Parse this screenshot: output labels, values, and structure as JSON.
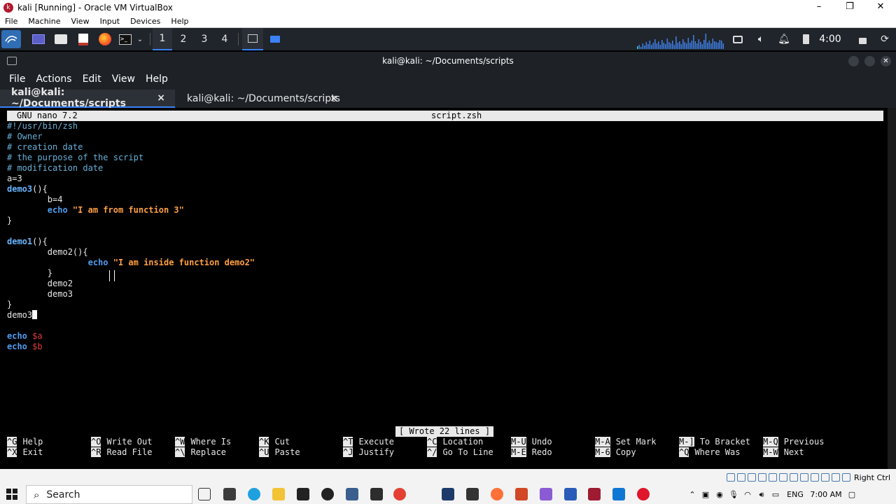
{
  "host_window": {
    "title": "kali [Running] - Oracle VM VirtualBox",
    "menu": [
      "File",
      "Machine",
      "View",
      "Input",
      "Devices",
      "Help"
    ]
  },
  "kali_panel": {
    "workspaces": [
      "1",
      "2",
      "3",
      "4"
    ],
    "active_workspace": "1",
    "clock": "4:00"
  },
  "terminal": {
    "title": "kali@kali: ~/Documents/scripts",
    "menu": [
      "File",
      "Actions",
      "Edit",
      "View",
      "Help"
    ],
    "tabs": [
      {
        "label": "kali@kali: ~/Documents/scripts",
        "close": "×"
      },
      {
        "label": "kali@kali: ~/Documents/scripts",
        "close": "×"
      }
    ]
  },
  "nano": {
    "version": "GNU nano 7.2",
    "filename": "script.zsh",
    "status_message": "[ Wrote 22 lines ]",
    "lines": {
      "l1": "#!/usr/bin/zsh",
      "l2": "# Owner",
      "l3": "# creation date",
      "l4": "# the purpose of the script",
      "l5": "# modification date",
      "l6": "a=3",
      "l7_fn": "demo3",
      "l7_rest": "(){",
      "l8": "        b=4",
      "l9_indent": "        ",
      "l9_kw": "echo",
      "l9_str": " \"I am from function 3\"",
      "l10": "}",
      "l12_fn": "demo1",
      "l12_rest": "(){",
      "l13": "        demo2(){",
      "l14_indent": "                ",
      "l14_kw": "echo",
      "l14_str": " \"I am inside function demo2\"",
      "l15": "        }",
      "l16": "        demo2",
      "l17": "        demo3",
      "l18": "}",
      "l19": "demo3",
      "l21_kw": "echo",
      "l21_var": " $a",
      "l22_kw": "echo",
      "l22_var": " $b"
    },
    "shortcuts": [
      {
        "k1": "^G",
        "a1": "Help",
        "k2": "^X",
        "a2": "Exit"
      },
      {
        "k1": "^O",
        "a1": "Write Out",
        "k2": "^R",
        "a2": "Read File"
      },
      {
        "k1": "^W",
        "a1": "Where Is",
        "k2": "^\\",
        "a2": "Replace"
      },
      {
        "k1": "^K",
        "a1": "Cut",
        "k2": "^U",
        "a2": "Paste"
      },
      {
        "k1": "^T",
        "a1": "Execute",
        "k2": "^J",
        "a2": "Justify"
      },
      {
        "k1": "^C",
        "a1": "Location",
        "k2": "^/",
        "a2": "Go To Line"
      },
      {
        "k1": "M-U",
        "a1": "Undo",
        "k2": "M-E",
        "a2": "Redo"
      },
      {
        "k1": "M-A",
        "a1": "Set Mark",
        "k2": "M-6",
        "a2": "Copy"
      },
      {
        "k1": "M-]",
        "a1": "To Bracket",
        "k2": "^Q",
        "a2": "Where Was"
      },
      {
        "k1": "M-Q",
        "a1": "Previous",
        "k2": "M-W",
        "a2": "Next"
      }
    ]
  },
  "taskbar": {
    "search_placeholder": "Search",
    "tray_label": "Right Ctrl",
    "language": "ENG",
    "time": "7:00 AM"
  }
}
